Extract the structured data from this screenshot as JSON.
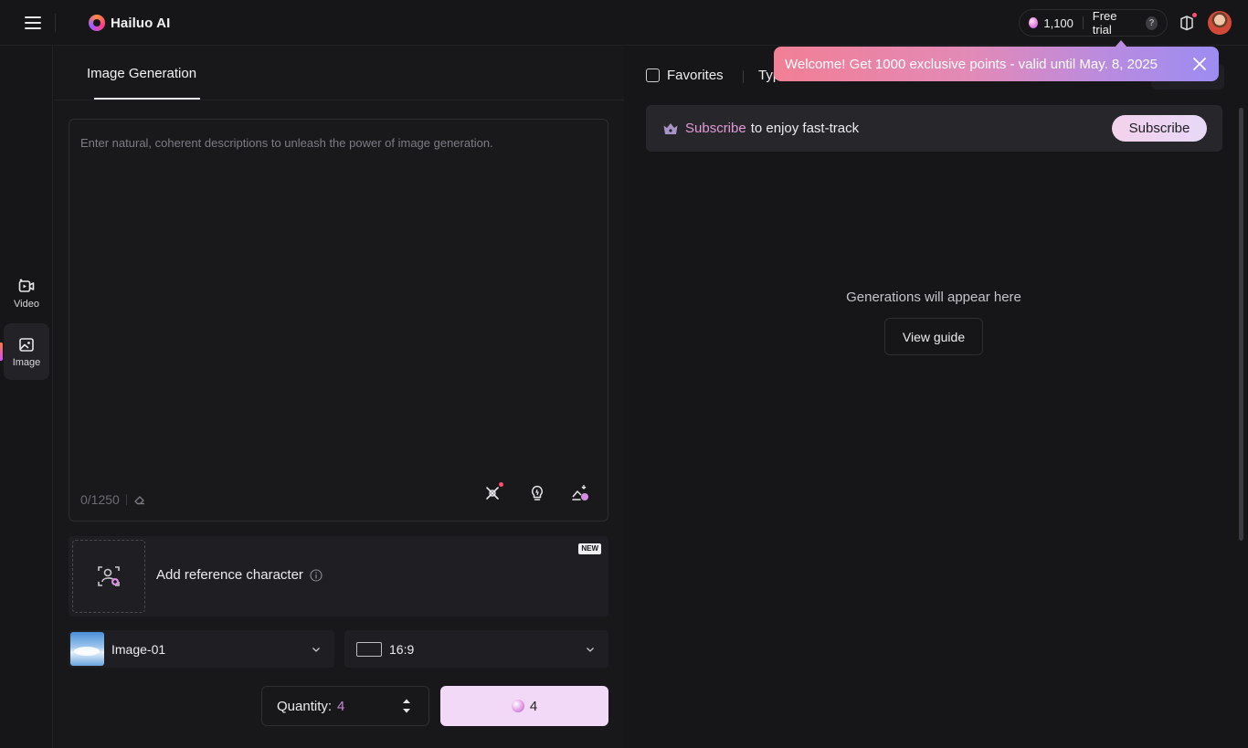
{
  "header": {
    "brand": "Hailuo AI",
    "points": "1,100",
    "free_trial": "Free trial",
    "help": "?"
  },
  "rail": {
    "items": [
      {
        "label": "Video",
        "icon": "video-icon"
      },
      {
        "label": "Image",
        "icon": "image-icon",
        "active": true
      }
    ]
  },
  "left": {
    "tab": "Image Generation",
    "prompt_placeholder": "Enter natural, coherent descriptions to unleash the power of image generation.",
    "counter": "0/1250",
    "reference": {
      "label": "Add reference character",
      "badge": "NEW"
    },
    "model": "Image-01",
    "aspect_ratio": "16:9",
    "quantity_label": "Quantity:",
    "quantity_value": "4",
    "generate_cost": "4"
  },
  "right": {
    "favorites": "Favorites",
    "type_filter": "Typ",
    "toast": "Welcome! Get 1000 exclusive points - valid until May. 8, 2025",
    "subscribe_highlight": "Subscribe",
    "subscribe_rest": "to enjoy fast-track",
    "subscribe_button": "Subscribe",
    "empty_text": "Generations will appear here",
    "guide_button": "View guide"
  },
  "colors": {
    "accent": "#f2d9f7",
    "highlight": "#e29ad8",
    "toast_start": "#f27f95",
    "toast_end": "#9c8cf2"
  }
}
